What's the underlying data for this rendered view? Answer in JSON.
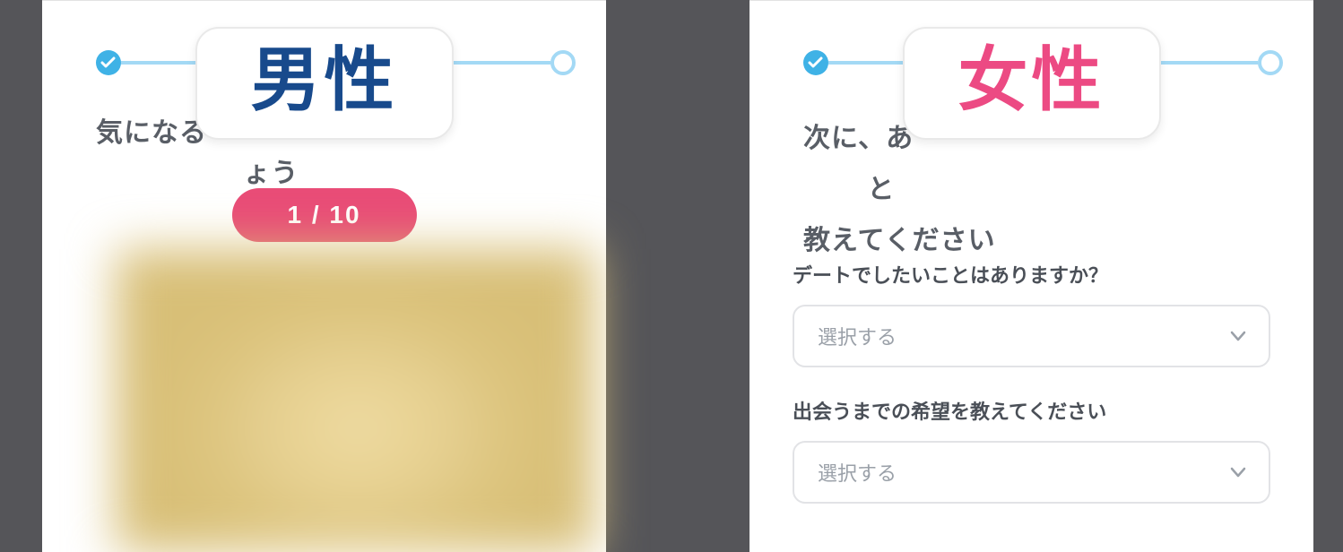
{
  "left": {
    "badge": "男性",
    "heading_prefix": "気になる",
    "heading_suffix": "ょう",
    "pill": "1 / 10"
  },
  "right": {
    "badge": "女性",
    "heading_a_prefix": "次に、あ",
    "heading_a_suffix": "と",
    "heading_b": "教えてください",
    "q1_label": "デートでしたいことはありますか？",
    "q1_placeholder": "選択する",
    "q2_label": "出会うまでの希望を教えてください",
    "q2_placeholder": "選択する"
  },
  "colors": {
    "male": "#184a8c",
    "female": "#ec4a83",
    "accent_pill": "#e94c77",
    "progress_line": "#a3d9f5",
    "progress_fill": "#3fb2e6"
  }
}
